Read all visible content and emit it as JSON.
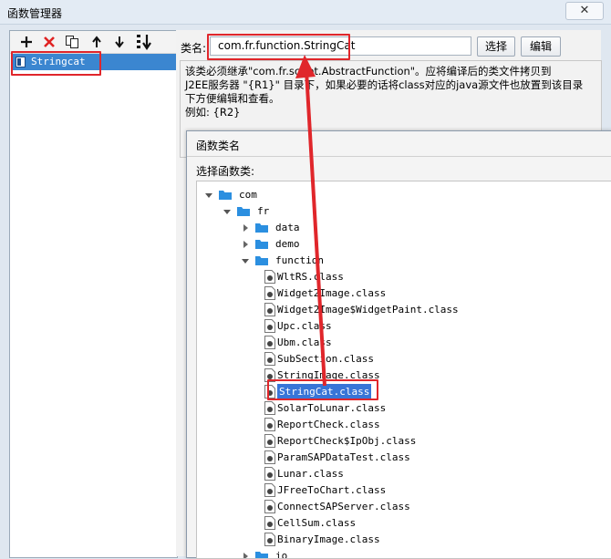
{
  "window": {
    "title": "函数管理器",
    "close_glyph": "✕"
  },
  "left": {
    "toolbar": [
      {
        "name": "add-icon"
      },
      {
        "name": "delete-icon"
      },
      {
        "name": "copy-icon"
      },
      {
        "name": "move-up-icon"
      },
      {
        "name": "move-down-icon"
      },
      {
        "name": "sort-icon"
      }
    ],
    "items": [
      {
        "label": "Stringcat",
        "selected": true
      }
    ]
  },
  "right": {
    "class_label": "类名:",
    "class_value": "com.fr.function.StringCat",
    "select_button": "选择",
    "edit_button": "编辑",
    "description": [
      "该类必须继承\"com.fr.script.AbstractFunction\"。应将编译后的类文件拷贝到",
      "J2EE服务器 \"{R1}\" 目录下，如果必要的话将class对应的java源文件也放置到该目录",
      "下方便编辑和查看。",
      "例如: {R2}"
    ]
  },
  "dialog": {
    "title": "函数类名",
    "label": "选择函数类:",
    "tree": [
      {
        "label": "com",
        "type": "folder",
        "level": 0,
        "expanded": true
      },
      {
        "label": "fr",
        "type": "folder",
        "level": 1,
        "expanded": true
      },
      {
        "label": "data",
        "type": "folder",
        "level": 2,
        "expanded": false
      },
      {
        "label": "demo",
        "type": "folder",
        "level": 2,
        "expanded": false
      },
      {
        "label": "function",
        "type": "folder",
        "level": 2,
        "expanded": true
      },
      {
        "label": "WltRS.class",
        "type": "file",
        "level": 3
      },
      {
        "label": "Widget2Image.class",
        "type": "file",
        "level": 3
      },
      {
        "label": "Widget2Image$WidgetPaint.class",
        "type": "file",
        "level": 3
      },
      {
        "label": "Upc.class",
        "type": "file",
        "level": 3
      },
      {
        "label": "Ubm.class",
        "type": "file",
        "level": 3
      },
      {
        "label": "SubSection.class",
        "type": "file",
        "level": 3
      },
      {
        "label": "StringImage.class",
        "type": "file",
        "level": 3
      },
      {
        "label": "StringCat.class",
        "type": "file",
        "level": 3,
        "selected": true
      },
      {
        "label": "SolarToLunar.class",
        "type": "file",
        "level": 3
      },
      {
        "label": "ReportCheck.class",
        "type": "file",
        "level": 3
      },
      {
        "label": "ReportCheck$IpObj.class",
        "type": "file",
        "level": 3
      },
      {
        "label": "ParamSAPDataTest.class",
        "type": "file",
        "level": 3
      },
      {
        "label": "Lunar.class",
        "type": "file",
        "level": 3
      },
      {
        "label": "JFreeToChart.class",
        "type": "file",
        "level": 3
      },
      {
        "label": "ConnectSAPServer.class",
        "type": "file",
        "level": 3
      },
      {
        "label": "CellSum.class",
        "type": "file",
        "level": 3
      },
      {
        "label": "BinaryImage.class",
        "type": "file",
        "level": 3
      },
      {
        "label": "io",
        "type": "folder",
        "level": 2,
        "expanded": false
      }
    ]
  },
  "colors": {
    "annotation": "#e0262b",
    "selection": "#3875d7",
    "folder": "#2b8fe0"
  }
}
